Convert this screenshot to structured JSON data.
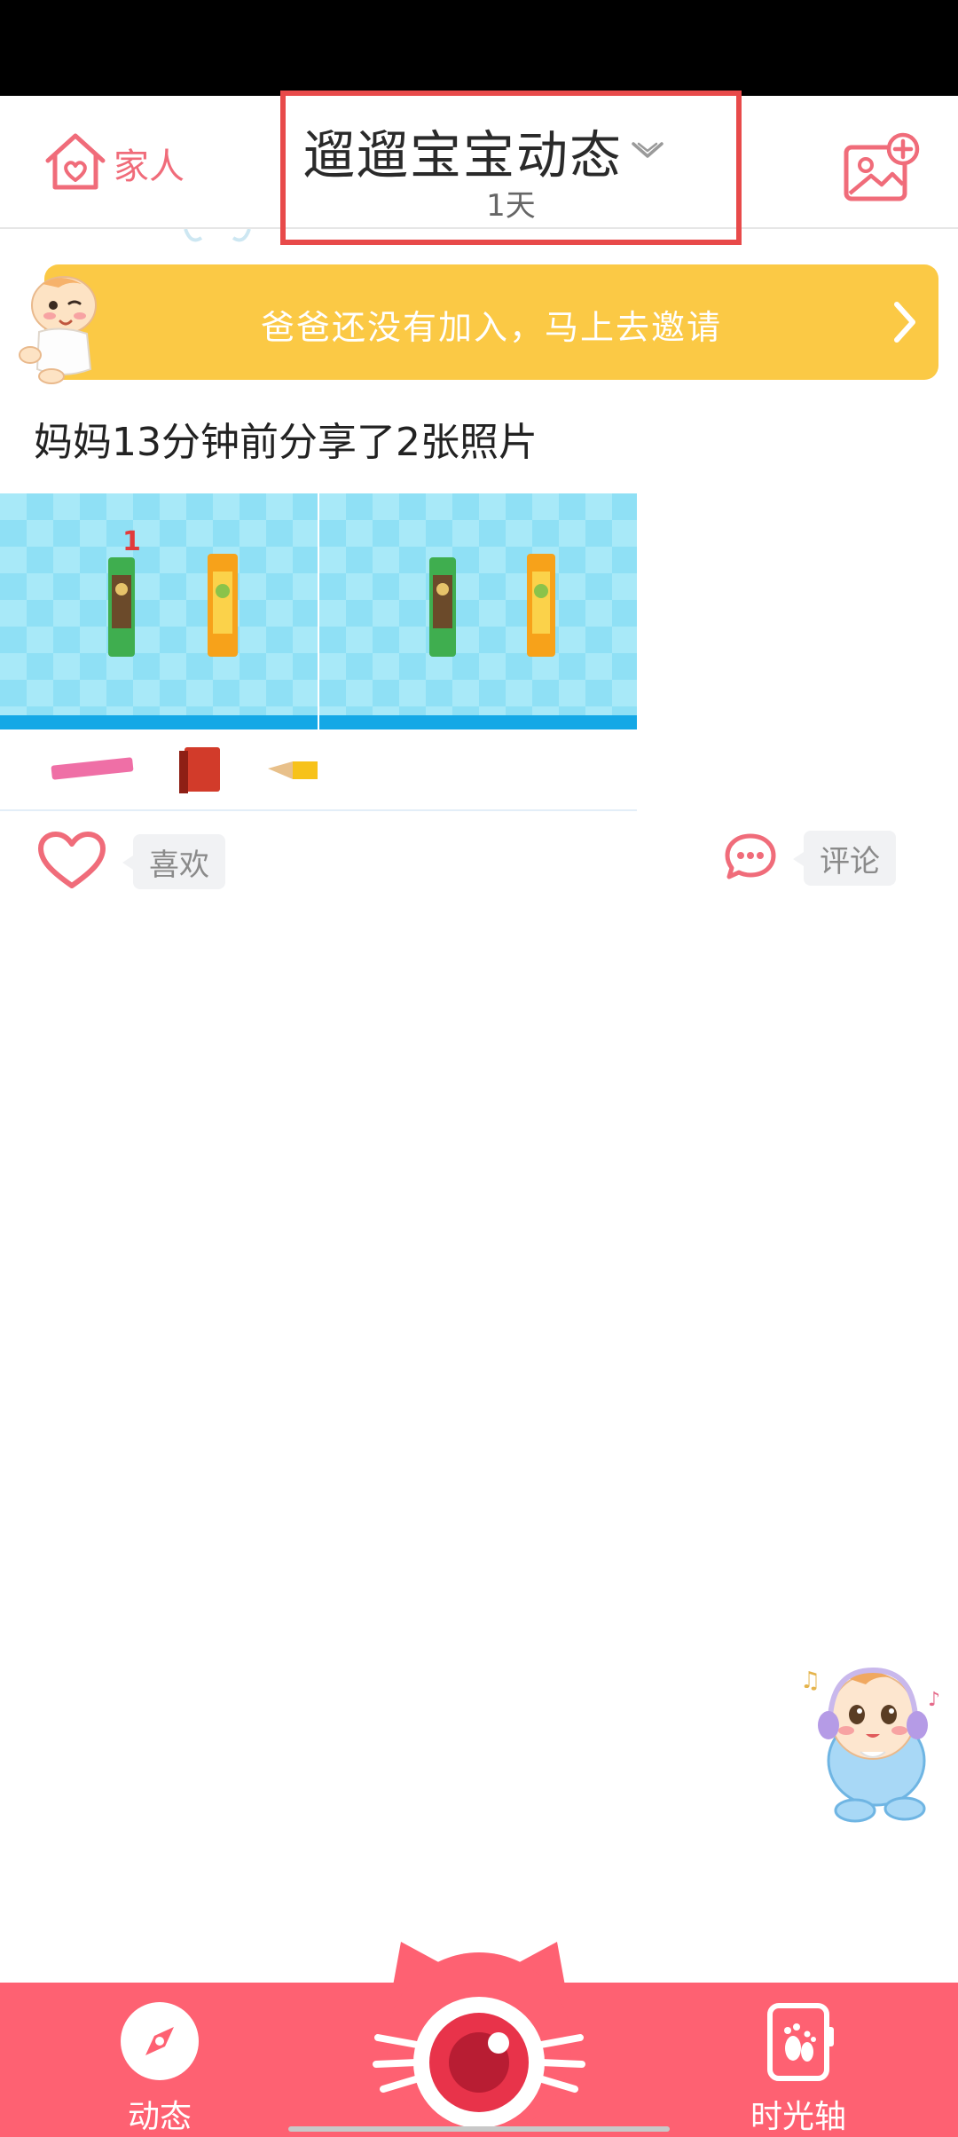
{
  "header": {
    "family_label": "家人",
    "title": "遛遛宝宝动态",
    "subtitle": "1天"
  },
  "invite_banner": {
    "text": "爸爸还没有加入，马上去邀请"
  },
  "post": {
    "description": "妈妈13分钟前分享了2张照片",
    "photo_number_label": "1",
    "like_label": "喜欢",
    "comment_label": "评论"
  },
  "bottom_nav": {
    "dynamic_label": "动态",
    "timeline_label": "时光轴"
  },
  "colors": {
    "accent": "#fe6172",
    "banner": "#fbc945",
    "highlight_border": "#e84a4a",
    "icon_pink": "#f06c7a"
  },
  "icons": [
    "house-heart-icon",
    "chevron-down-icon",
    "photo-add-icon",
    "chevron-right-icon",
    "heart-icon",
    "comment-icon",
    "compass-icon",
    "camera-icon",
    "footprint-card-icon"
  ]
}
